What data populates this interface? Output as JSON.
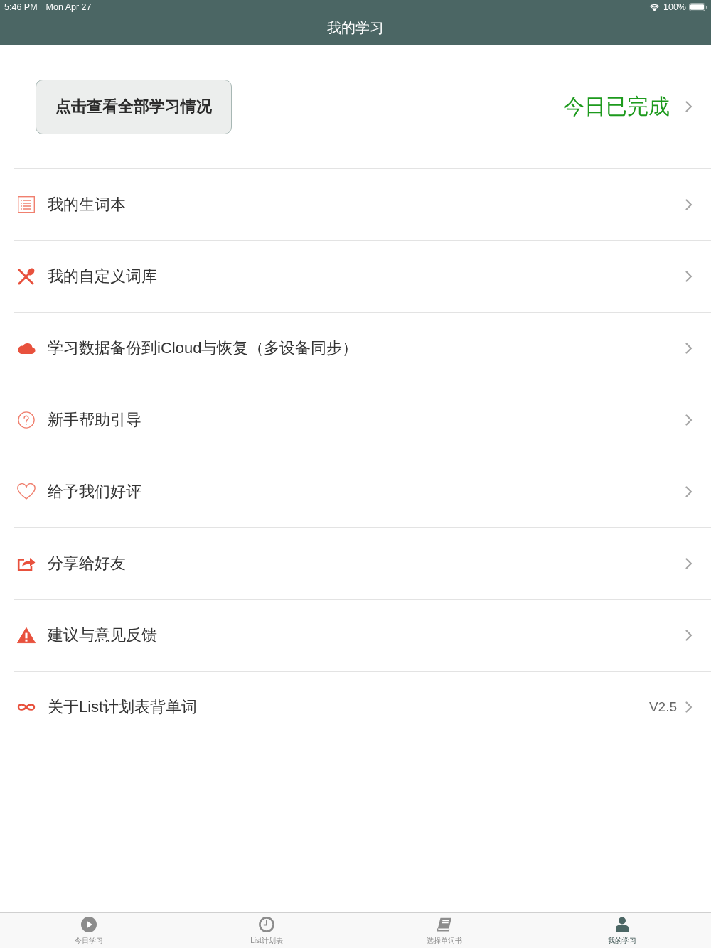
{
  "status_bar": {
    "time": "5:46 PM",
    "date": "Mon Apr 27",
    "battery": "100%"
  },
  "nav_bar": {
    "title": "我的学习"
  },
  "summary": {
    "button": "点击查看全部学习情况",
    "status": "今日已完成"
  },
  "menu": [
    {
      "kind": "list",
      "label": "我的生词本"
    },
    {
      "kind": "utensils",
      "label": "我的自定义词库"
    },
    {
      "kind": "cloud",
      "label": "学习数据备份到iCloud与恢复（多设备同步）"
    },
    {
      "kind": "help",
      "label": "新手帮助引导"
    },
    {
      "kind": "heart",
      "label": "给予我们好评"
    },
    {
      "kind": "share",
      "label": "分享给好友"
    },
    {
      "kind": "warning",
      "label": "建议与意见反馈"
    },
    {
      "kind": "infinity",
      "label": "关于List计划表背单词",
      "detail": "V2.5"
    }
  ],
  "tab_bar": [
    {
      "kind": "play",
      "label": "今日学习",
      "selected": false
    },
    {
      "kind": "clock",
      "label": "List计划表",
      "selected": false
    },
    {
      "kind": "book",
      "label": "选择单词书",
      "selected": false
    },
    {
      "kind": "person",
      "label": "我的学习",
      "selected": true
    }
  ]
}
